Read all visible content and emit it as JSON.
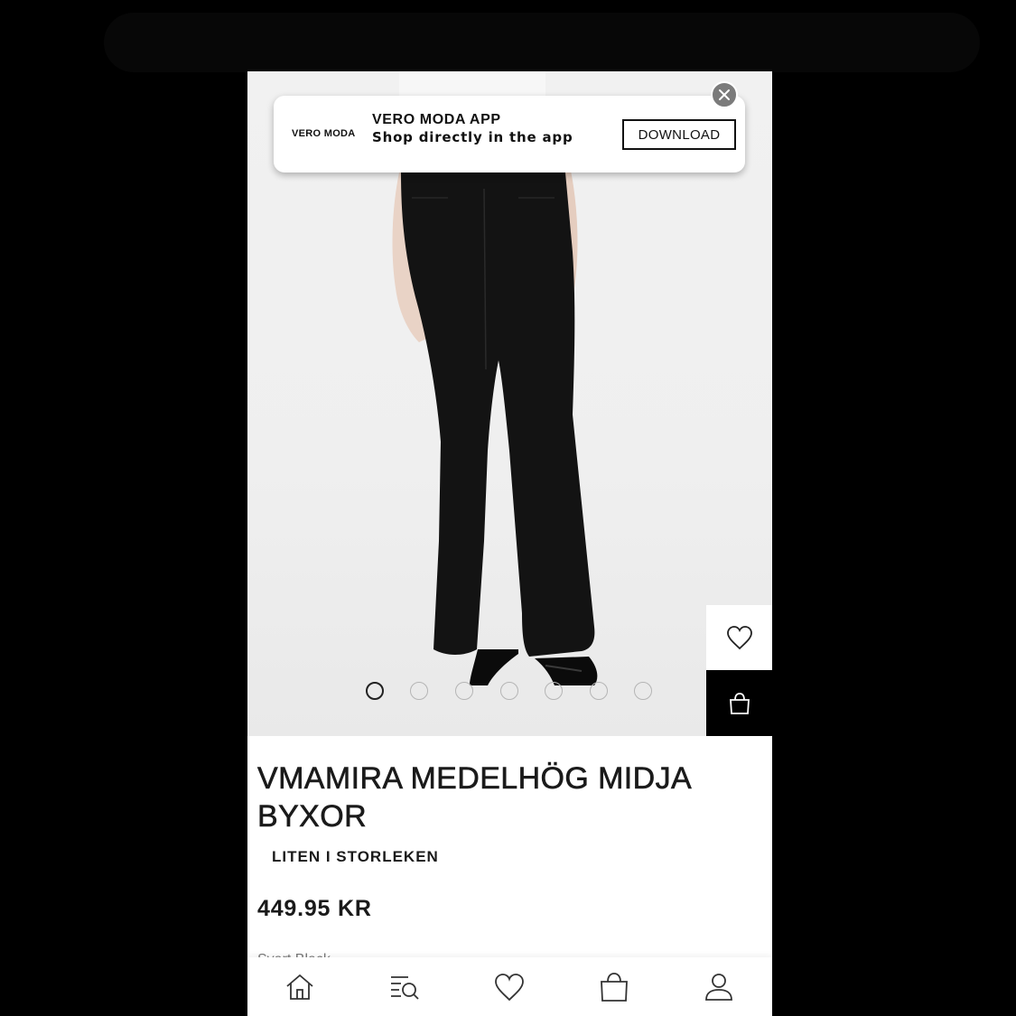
{
  "banner": {
    "logo_text": "VERO MODA",
    "title": "VERO MODA APP",
    "subtitle": "Shop directly in the app",
    "download_label": "DOWNLOAD"
  },
  "gallery": {
    "image_count": 7,
    "active_index": 0
  },
  "product": {
    "title": "VMAMIRA MEDELHÖG MIDJA BYXOR",
    "fit_note": "LITEN I STORLEKEN",
    "price": "449.95 KR",
    "cut_text": "Svart Black"
  },
  "nav": {
    "items": [
      "home-icon",
      "search-menu-icon",
      "heart-icon",
      "bag-icon",
      "profile-icon"
    ]
  },
  "colors": {
    "brand": "#000000",
    "background": "#ffffff",
    "close_button": "#7b7b7b"
  }
}
